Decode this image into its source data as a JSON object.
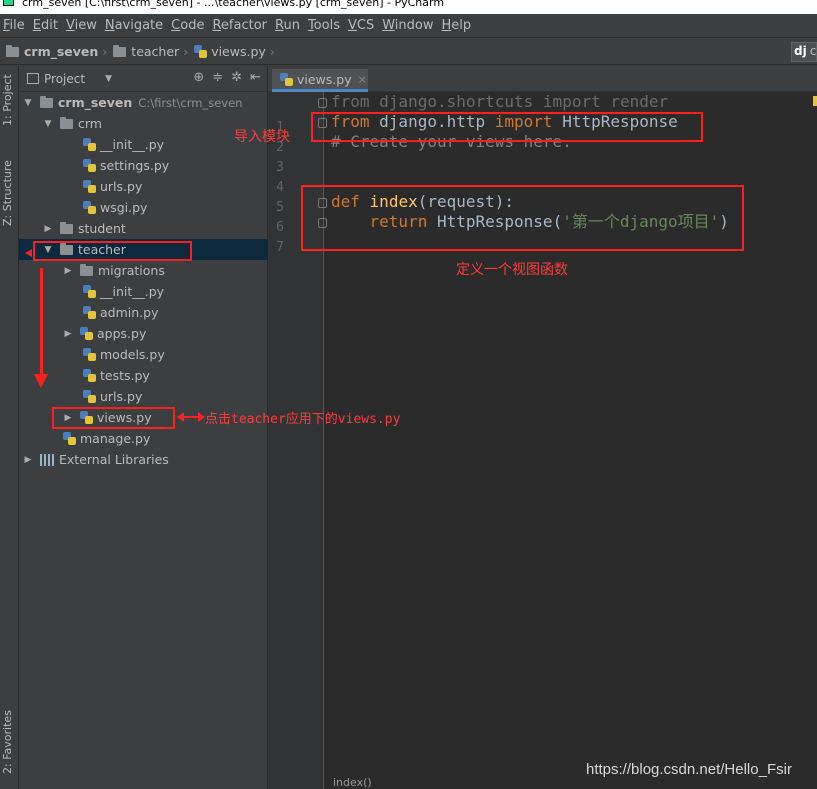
{
  "title_bar": {
    "text": "crm_seven [C:\\first\\crm_seven] - ...\\teacher\\views.py [crm_seven] - PyCharm"
  },
  "menu": [
    "File",
    "Edit",
    "View",
    "Navigate",
    "Code",
    "Refactor",
    "Run",
    "Tools",
    "VCS",
    "Window",
    "Help"
  ],
  "nav": {
    "crumbs": [
      "crm_seven",
      "teacher",
      "views.py"
    ],
    "dj": "dj",
    "dj_extra": "c"
  },
  "left_strip": {
    "project_tab": "1: Project",
    "structure_tab": "Z: Structure",
    "favorites_tab": "2: Favorites"
  },
  "project_panel": {
    "header": "Project"
  },
  "tree": [
    {
      "label": "crm_seven",
      "hint": "C:\\first\\crm_seven",
      "arrow": "▼",
      "icon": "folder"
    },
    {
      "label": "crm",
      "arrow": "▼",
      "icon": "folder"
    },
    {
      "label": "__init__.py",
      "icon": "python-file"
    },
    {
      "label": "settings.py",
      "icon": "python-file"
    },
    {
      "label": "urls.py",
      "icon": "python-file"
    },
    {
      "label": "wsgi.py",
      "icon": "python-file"
    },
    {
      "label": "student",
      "arrow": "▶",
      "icon": "folder"
    },
    {
      "label": "teacher",
      "arrow": "▼",
      "icon": "folder"
    },
    {
      "label": "migrations",
      "arrow": "▶",
      "icon": "folder"
    },
    {
      "label": "__init__.py",
      "icon": "python-file"
    },
    {
      "label": "admin.py",
      "icon": "python-file"
    },
    {
      "label": "apps.py",
      "arrow": "▶",
      "icon": "python-file"
    },
    {
      "label": "models.py",
      "icon": "python-file"
    },
    {
      "label": "tests.py",
      "icon": "python-file"
    },
    {
      "label": "urls.py",
      "icon": "python-file"
    },
    {
      "label": "views.py",
      "arrow": "▶",
      "icon": "python-file"
    },
    {
      "label": "manage.py",
      "icon": "python-file"
    },
    {
      "label": "External Libraries",
      "arrow": "▶",
      "icon": "library"
    }
  ],
  "editor": {
    "tab": "views.py",
    "tab_close": "×",
    "line_numbers": [
      "1",
      "2",
      "3",
      "4",
      "5",
      "6",
      "7"
    ],
    "code": {
      "l1": "from django.shortcuts import render",
      "l2_from": "from",
      "l2_mod": " django.http ",
      "l2_import": "import",
      "l2_name": " HttpResponse",
      "l3": "# Create your views here.",
      "l6_def": "def",
      "l6_name": "index",
      "l6_rest": "(request):",
      "l7_ret": "return",
      "l7_call": "HttpResponse",
      "l7_open": "(",
      "l7_str": "'第一个django项目'",
      "l7_close": ")"
    },
    "bottom_crumb": "index()"
  },
  "annotations": {
    "import_module": "导入模块",
    "define_view": "定义一个视图函数",
    "click_views": "点击teacher应用下的views.py"
  },
  "watermark": "https://blog.csdn.net/Hello_Fsir",
  "colors": {
    "selection": "#0d293e",
    "annotation_red": "#ff2020",
    "keyword": "#cc7832",
    "string": "#6a8759"
  }
}
